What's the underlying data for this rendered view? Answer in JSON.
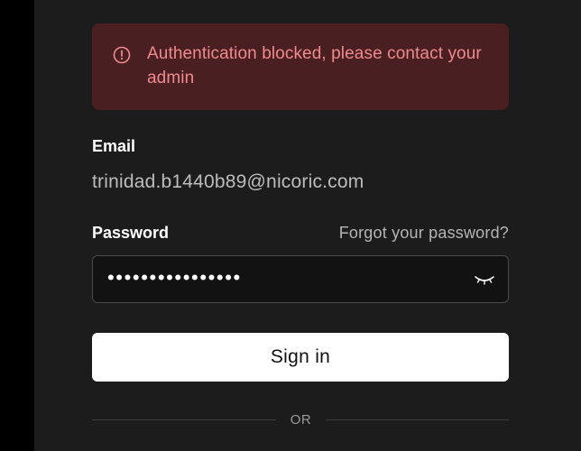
{
  "alert": {
    "icon": "exclamation-circle-icon",
    "message": "Authentication blocked, please contact your admin",
    "color": "#f08a8e",
    "background": "#4a1f22"
  },
  "email": {
    "label": "Email",
    "value": "trinidad.b1440b89@nicoric.com"
  },
  "password": {
    "label": "Password",
    "forgot_link": "Forgot your password?",
    "masked_value": "••••••••••••••••",
    "toggle_icon": "eye-closed-icon"
  },
  "signin_button": {
    "label": "Sign in"
  },
  "divider": {
    "text": "OR"
  }
}
